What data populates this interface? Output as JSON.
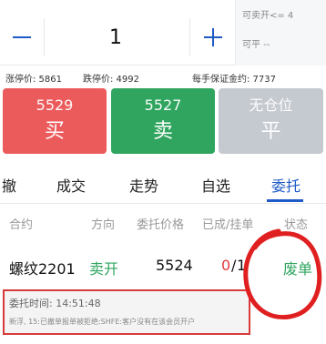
{
  "stepper": {
    "quantity": "1"
  },
  "side_info": {
    "sellable": "可卖开<= 4",
    "closeable": "可平     --"
  },
  "price_info": {
    "limit_up": "涨停价: 5861",
    "limit_down": "跌停价: 4992",
    "margin": "每手保证金约: 7737"
  },
  "buttons": {
    "buy": {
      "price": "5529",
      "label": "买"
    },
    "sell": {
      "price": "5527",
      "label": "卖"
    },
    "close": {
      "price": "无仓位",
      "label": "平"
    }
  },
  "tabs": [
    "撤",
    "成交",
    "走势",
    "自选",
    "委托"
  ],
  "active_tab": "委托",
  "table_headers": [
    "合约",
    "方向",
    "委托价格",
    "已成/挂单",
    "状态"
  ],
  "order": {
    "contract": "螺纹2201",
    "direction": "卖开",
    "price": "5524",
    "filled": "0",
    "slash": "/",
    "pending": "1",
    "status": "废单"
  },
  "detail": {
    "time": "委托时间: 14:51:48",
    "message": "新浮, 15:已撤单报单被拒绝:SHFE:客户没有在该会员开户"
  },
  "colors": {
    "accent": "#1e5bc6",
    "buy": "#ec5b5b",
    "sell": "#2fa55f",
    "disabled": "#c5c9d0",
    "annotation": "#e02020"
  }
}
